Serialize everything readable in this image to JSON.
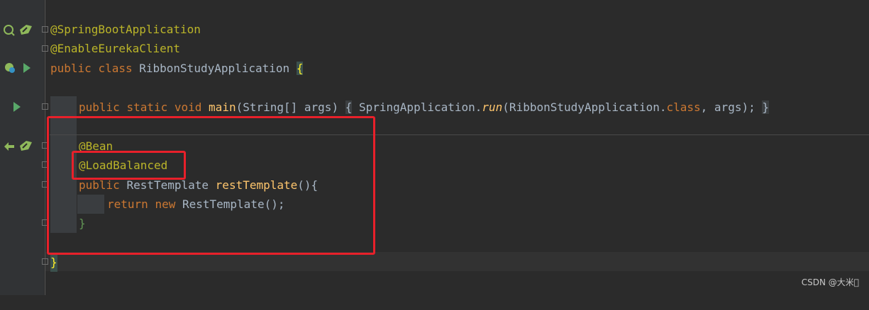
{
  "code": {
    "line1": "@SpringBootApplication",
    "line2": "@EnableEurekaClient",
    "line3": {
      "public": "public",
      "class": "class",
      "name": "RibbonStudyApplication",
      "brace": "{"
    },
    "line5": {
      "public": "public",
      "static": "static",
      "void": "void",
      "main": "main",
      "params": "(String[] args)",
      "open": "{",
      "spring": "SpringApplication.",
      "run": "run",
      "arg_open": "(RibbonStudyApplication.",
      "class_kw": "class",
      "rest": ", args);",
      "close": "}"
    },
    "line7": "@Bean",
    "line8": "@LoadBalanced",
    "line9": {
      "public": "public",
      "type": "RestTemplate",
      "method": "restTemplate",
      "rest": "(){"
    },
    "line10": {
      "return": "return",
      "new": "new",
      "rest": "RestTemplate();"
    },
    "line11": "}",
    "line13": "}"
  },
  "gutter_icons": [
    "spring-bean-icon",
    "run-icon",
    "run-main-icon",
    "bean-navigation-icon"
  ],
  "watermark": "CSDN @大米\u0000",
  "colors": {
    "keyword": "#cc7832",
    "annotation": "#bbb529",
    "method": "#ffc66d",
    "text": "#a9b7c6",
    "highlight": "#e8202a"
  }
}
